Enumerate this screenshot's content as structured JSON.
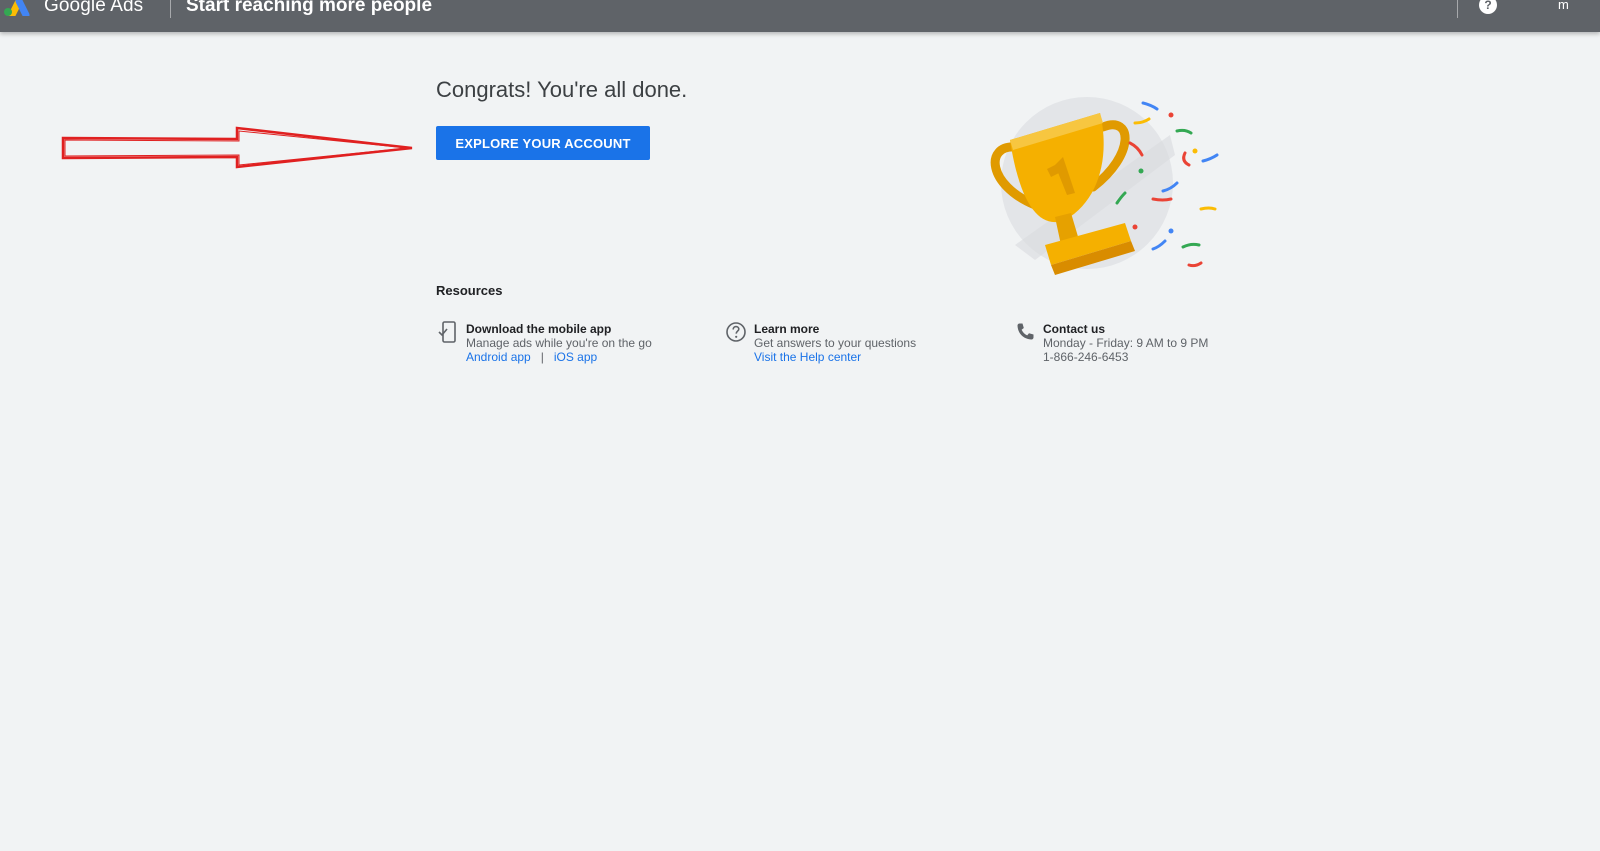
{
  "header": {
    "product_name": "Google Ads",
    "title": "Start reaching more people",
    "help_icon": "help-circle-icon",
    "account_initial": "m"
  },
  "main": {
    "heading": "Congrats! You're all done.",
    "explore_button": "EXPLORE YOUR ACCOUNT",
    "illustration": "trophy-confetti-illustration"
  },
  "resources": {
    "title": "Resources",
    "items": [
      {
        "icon": "phone-check-icon",
        "title": "Download the mobile app",
        "description": "Manage ads while you're on the go",
        "links": [
          "Android app",
          "iOS app"
        ],
        "separator": "|"
      },
      {
        "icon": "help-outline-icon",
        "title": "Learn more",
        "description": "Get answers to your questions",
        "link": "Visit the Help center"
      },
      {
        "icon": "phone-icon",
        "title": "Contact us",
        "description": "Monday - Friday: 9 AM to 9 PM",
        "phone": "1-866-246-6453"
      }
    ]
  },
  "colors": {
    "header_bg": "#5f6368",
    "page_bg": "#f1f3f4",
    "primary_button": "#1a73e8",
    "link": "#1a73e8",
    "annotation_arrow": "#e02020",
    "trophy_gold": "#f0a500"
  }
}
